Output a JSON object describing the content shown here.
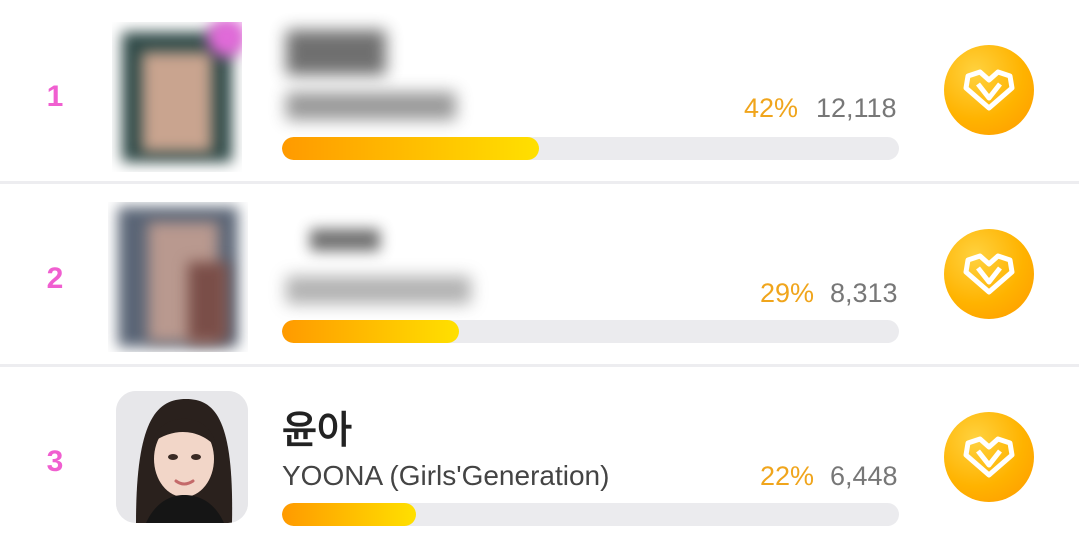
{
  "ranking": [
    {
      "rank": "1",
      "name": "",
      "group": "",
      "percent": "42%",
      "votes": "12,118",
      "share": 0.42,
      "photo_visible": false
    },
    {
      "rank": "2",
      "name": "",
      "group": "",
      "percent": "29%",
      "votes": "8,313",
      "share": 0.29,
      "photo_visible": false
    },
    {
      "rank": "3",
      "name": "윤아",
      "group": "YOONA (Girls'Generation)",
      "percent": "22%",
      "votes": "6,448",
      "share": 0.22,
      "photo_visible": true
    }
  ],
  "colors": {
    "rank": "#f05fd0",
    "percent": "#f0a51c",
    "bar_start": "#ff9a00",
    "bar_end": "#ffe000",
    "vote_button": "#ffb300"
  },
  "icons": {
    "vote_button": "heart-gem-vote-icon"
  }
}
